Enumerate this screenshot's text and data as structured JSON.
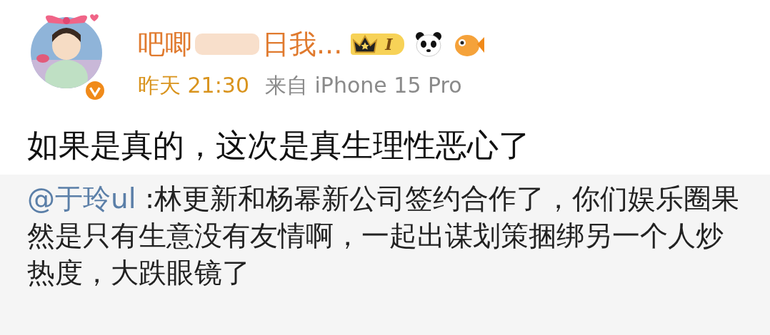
{
  "post": {
    "author": {
      "name_parts": [
        "吧唧",
        "日我..."
      ],
      "verified": true,
      "level_badge": "I"
    },
    "time": "昨天 21:30",
    "source": "来自 iPhone 15 Pro",
    "text": "如果是真的，这次是真生理性恶心了",
    "repost": {
      "mention": "@于玲ul",
      "text": " :林更新和杨幂新公司签约合作了，你们娱乐圈果然是只有生意没有友情啊，一起出谋划策捆绑另一个人炒热度，大跌眼镜了"
    }
  }
}
